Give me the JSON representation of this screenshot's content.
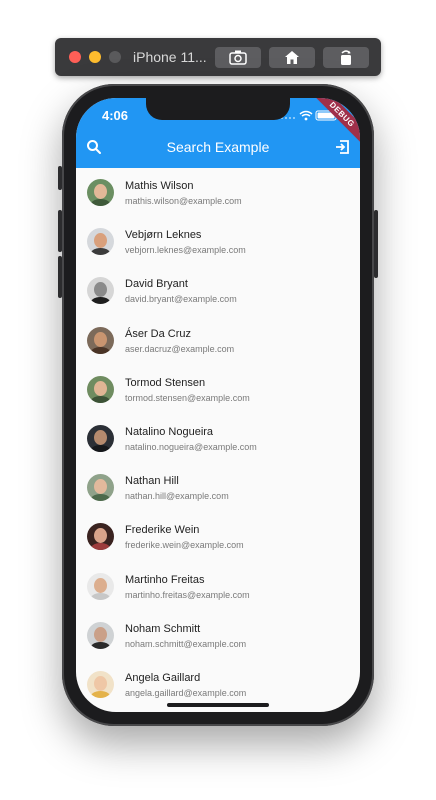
{
  "simulator": {
    "title": "iPhone 11...",
    "buttons": [
      "screenshot",
      "home",
      "rotate"
    ]
  },
  "status_bar": {
    "time": "4:06"
  },
  "debug_banner": "DEBUG",
  "app_bar": {
    "title": "Search Example",
    "color": "#2196f3",
    "left_icon": "search-icon",
    "right_icon": "exit-icon"
  },
  "contacts": [
    {
      "name": "Mathis Wilson",
      "email": "mathis.wilson@example.com"
    },
    {
      "name": "Vebjørn Leknes",
      "email": "vebjorn.leknes@example.com"
    },
    {
      "name": "David Bryant",
      "email": "david.bryant@example.com"
    },
    {
      "name": "Áser Da Cruz",
      "email": "aser.dacruz@example.com"
    },
    {
      "name": "Tormod Stensen",
      "email": "tormod.stensen@example.com"
    },
    {
      "name": "Natalino Nogueira",
      "email": "natalino.nogueira@example.com"
    },
    {
      "name": "Nathan Hill",
      "email": "nathan.hill@example.com"
    },
    {
      "name": "Frederike Wein",
      "email": "frederike.wein@example.com"
    },
    {
      "name": "Martinho Freitas",
      "email": "martinho.freitas@example.com"
    },
    {
      "name": "Noham Schmitt",
      "email": "noham.schmitt@example.com"
    },
    {
      "name": "Angela Gaillard",
      "email": "angela.gaillard@example.com"
    }
  ]
}
